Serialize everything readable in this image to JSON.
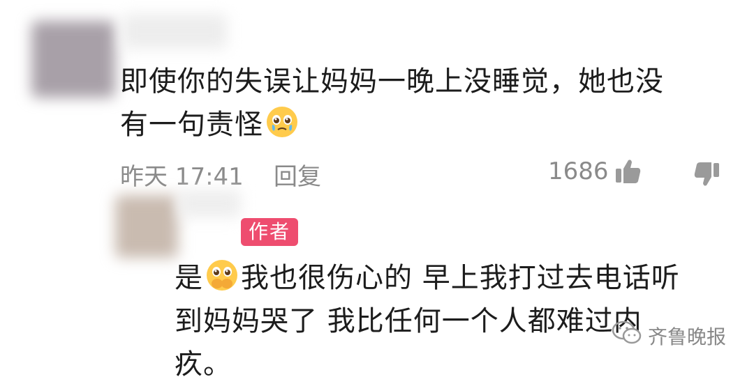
{
  "comment": {
    "text_line1": "即使你的失误让妈妈一晚上没睡觉，她也没",
    "text_line2_prefix": "有一句责怪",
    "emoji": "pleading-crying-face",
    "time": "昨天 17:41",
    "reply_label": "回复",
    "like_count": "1686"
  },
  "reply": {
    "badge": "作者",
    "prefix": "是",
    "emoji": "pleading-hands-over-mouth",
    "text_line1_rest": "我也很伤心的 早上我打过去电话听",
    "text_line2": "到妈妈哭了 我比任何一个人都难过内",
    "text_line3": "疚。"
  },
  "watermark": "齐鲁晚报"
}
